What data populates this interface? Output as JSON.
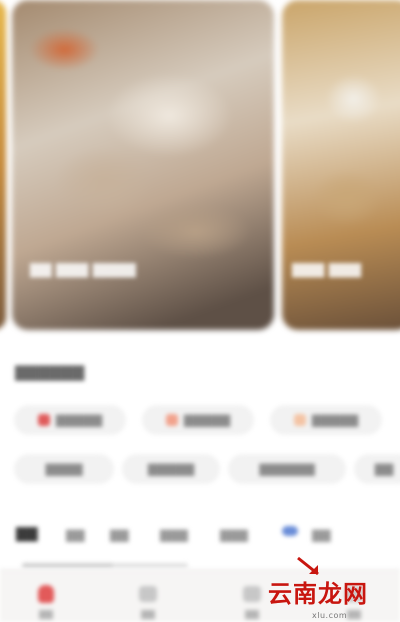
{
  "carousel": {
    "cards": [
      {
        "caption": "▇▇ ▇▇▇ ▇▇▇▇"
      },
      {
        "caption": "▇▇▇ ▇▇▇"
      }
    ]
  },
  "section": {
    "title": "▇▇▇▇▇▇"
  },
  "categories": {
    "row1": [
      {
        "label": "▇▇▇▇▇",
        "dot_color": "#e05b5b"
      },
      {
        "label": "▇▇▇▇▇",
        "dot_color": "#f2a28c"
      },
      {
        "label": "▇▇▇▇▇",
        "dot_color": "#f4c4a4"
      }
    ],
    "row2": [
      {
        "label": "▇▇▇▇"
      },
      {
        "label": "▇▇▇▇▇"
      },
      {
        "label": "▇▇▇▇▇▇"
      },
      {
        "label": "▇▇"
      }
    ]
  },
  "tabs": {
    "items": [
      "▇▇",
      "▇▇",
      "▇▇",
      "▇▇▇",
      "▇▇▇",
      "▇▇"
    ],
    "active_index": 0
  },
  "scroll_progress": 0.55,
  "bottom_nav": {
    "items": [
      {
        "label": "▇▇",
        "icon": "home-icon",
        "active": true,
        "color": "#e25a5a"
      },
      {
        "label": "▇▇",
        "icon": "grid-icon",
        "active": false,
        "color": "#c7c7c7"
      },
      {
        "label": "▇▇",
        "icon": "cart-icon",
        "active": false,
        "color": "#c7c7c7"
      },
      {
        "label": "▇▇",
        "icon": "profile-icon",
        "active": false,
        "color": "#c7c7c7"
      }
    ]
  },
  "watermark": {
    "title": "云南龙网",
    "subtitle": "xlu.com",
    "color": "#c8160f"
  }
}
